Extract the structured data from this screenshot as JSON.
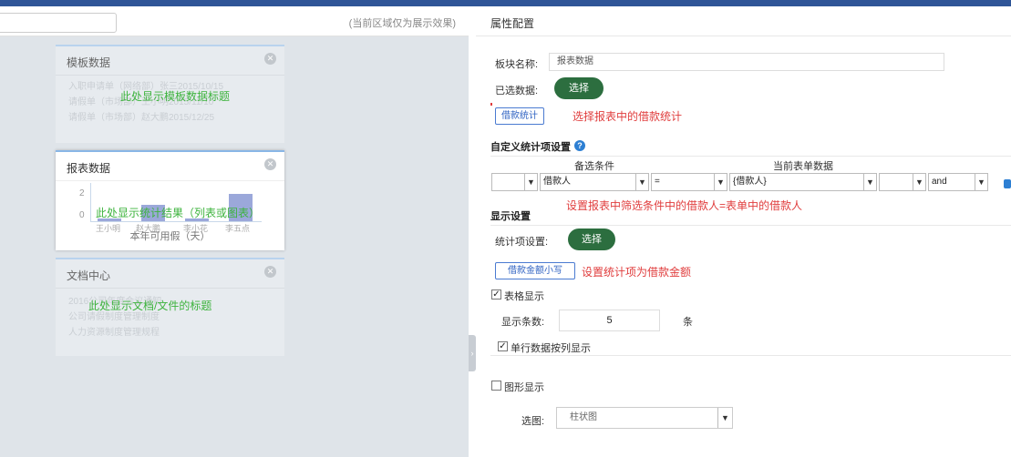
{
  "preview": {
    "hint": "(当前区域仅为展示效果)",
    "cards": [
      {
        "title": "模板数据",
        "list": [
          "入职申请单（网络部）张三2015/10/15",
          "请假单（市场部）王小明2015/11/10",
          "请假单（市场部）赵大鹏2015/12/25"
        ],
        "overlay": "此处显示模板数据标题"
      },
      {
        "title": "报表数据",
        "overlay": "此处显示统计结果（列表或图表）",
        "chart": {
          "yticks": [
            "2",
            "0"
          ],
          "xlabels": [
            "王小明",
            "赵大鹏",
            "李小花",
            "李五点"
          ],
          "values": [
            0.2,
            1.1,
            0.2,
            1.9
          ],
          "ymax": 2,
          "caption": "本年可用假（天）"
        }
      },
      {
        "title": "文档中心",
        "list": [
          "2016公司年度会议通知",
          "公司请假制度管理制度",
          "人力资源制度管理规程"
        ],
        "overlay": "此处显示文档/文件的标题"
      }
    ]
  },
  "config": {
    "title": "属性配置",
    "block_name_label": "板块名称:",
    "block_name_value": "报表数据",
    "selected_data_label": "已选数据:",
    "select_button": "选择",
    "data_tag": "借款统计",
    "data_note": "选择报表中的借款统计",
    "custom_title": "自定义统计项设置",
    "help_icon": "?",
    "col_condition": "备选条件",
    "col_current": "当前表单数据",
    "filter": {
      "field": "借款人",
      "operator": "=",
      "value": "{借款人}",
      "logic": "and"
    },
    "filter_note": "设置报表中筛选条件中的借款人=表单中的借款人",
    "display_title": "显示设置",
    "stat_label": "统计项设置:",
    "stat_button": "选择",
    "stat_tag": "借款金额小写",
    "stat_note": "设置统计项为借款金额",
    "table_display": "表格显示",
    "table_checked": true,
    "count_label": "显示条数:",
    "count_value": "5",
    "count_unit": "条",
    "single_row": "单行数据按列显示",
    "single_checked": true,
    "chart_display": "图形显示",
    "chart_checked": false,
    "chart_type_label": "选图:",
    "chart_type_value": "柱状图",
    "check_mark": "✓"
  }
}
